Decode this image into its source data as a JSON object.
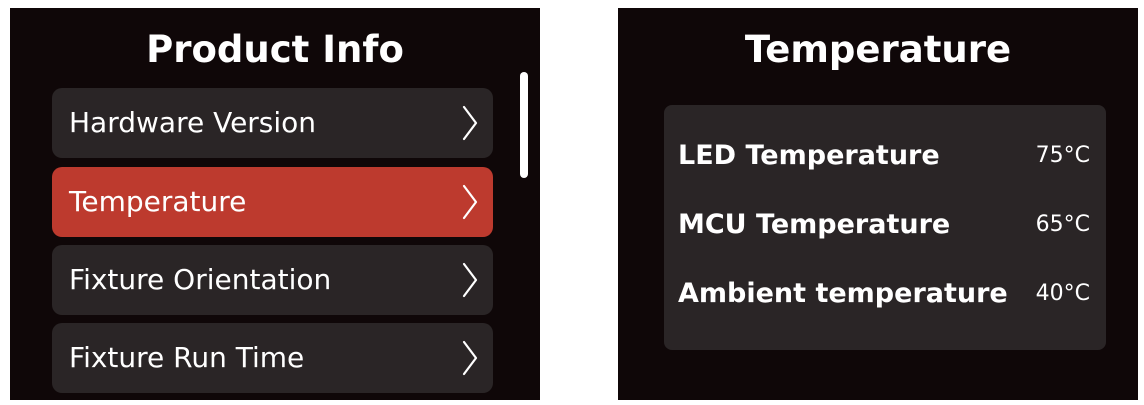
{
  "product_info_screen": {
    "title": "Product Info",
    "menu_items": [
      {
        "label": "Hardware Version",
        "selected": false
      },
      {
        "label": "Temperature",
        "selected": true
      },
      {
        "label": "Fixture Orientation",
        "selected": false
      },
      {
        "label": "Fixture Run Time",
        "selected": false
      }
    ],
    "chevron_icon": "chevron-right-icon"
  },
  "temperature_screen": {
    "title": "Temperature",
    "rows": [
      {
        "label": "LED Temperature",
        "value": "75°C"
      },
      {
        "label": "MCU Temperature",
        "value": "65°C"
      },
      {
        "label": "Ambient temperature",
        "value": "40°C"
      }
    ]
  },
  "colors": {
    "screen_background": "#0f0708",
    "item_background": "#2a2526",
    "selected_accent": "#bd3a2e",
    "text": "#ffffff"
  }
}
